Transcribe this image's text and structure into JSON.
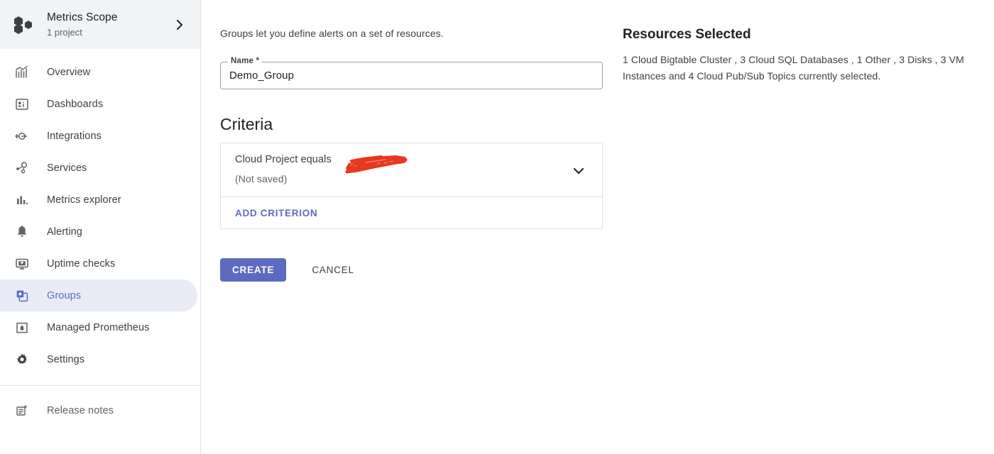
{
  "sidebar": {
    "scope": {
      "icon": "metrics-scope-hexagons-icon",
      "title": "Metrics Scope",
      "subtitle": "1 project",
      "chevron": "chevron-right-icon"
    },
    "items": [
      {
        "label": "Overview",
        "icon": "overview-chart-icon",
        "active": false
      },
      {
        "label": "Dashboards",
        "icon": "dashboards-grid-icon",
        "active": false
      },
      {
        "label": "Integrations",
        "icon": "integrations-plug-icon",
        "active": false
      },
      {
        "label": "Services",
        "icon": "services-nodes-icon",
        "active": false
      },
      {
        "label": "Metrics explorer",
        "icon": "bar-chart-icon",
        "active": false
      },
      {
        "label": "Alerting",
        "icon": "bell-icon",
        "active": false
      },
      {
        "label": "Uptime checks",
        "icon": "monitor-uptime-icon",
        "active": false
      },
      {
        "label": "Groups",
        "icon": "groups-squares-icon",
        "active": true
      },
      {
        "label": "Managed Prometheus",
        "icon": "prometheus-flame-icon",
        "active": false
      },
      {
        "label": "Settings",
        "icon": "gear-icon",
        "active": false
      }
    ],
    "footer": [
      {
        "label": "Release notes",
        "icon": "release-notes-icon"
      }
    ]
  },
  "main": {
    "intro": "Groups let you define alerts on a set of resources.",
    "name_field": {
      "label": "Name *",
      "value": "Demo_Group",
      "placeholder": "Name"
    },
    "criteria": {
      "heading": "Criteria",
      "rows": [
        {
          "text": "Cloud Project equals",
          "redacted": true,
          "status": "(Not saved)",
          "expand_icon": "chevron-down-icon"
        }
      ],
      "add_label": "ADD CRITERION"
    },
    "actions": {
      "create_label": "CREATE",
      "cancel_label": "CANCEL"
    }
  },
  "resources": {
    "title": "Resources Selected",
    "summary": "1 Cloud Bigtable Cluster , 3 Cloud SQL Databases , 1 Other , 3 Disks , 3 VM Instances and 4 Cloud Pub/Sub Topics currently selected."
  },
  "colors": {
    "accent": "#5c6bc0",
    "active_bg": "#e8eaf6",
    "header_bg": "#f1f3f4",
    "border": "#e0e0e0",
    "text_primary": "#202124",
    "text_secondary": "#5f6368",
    "redaction": "#e8381f"
  }
}
